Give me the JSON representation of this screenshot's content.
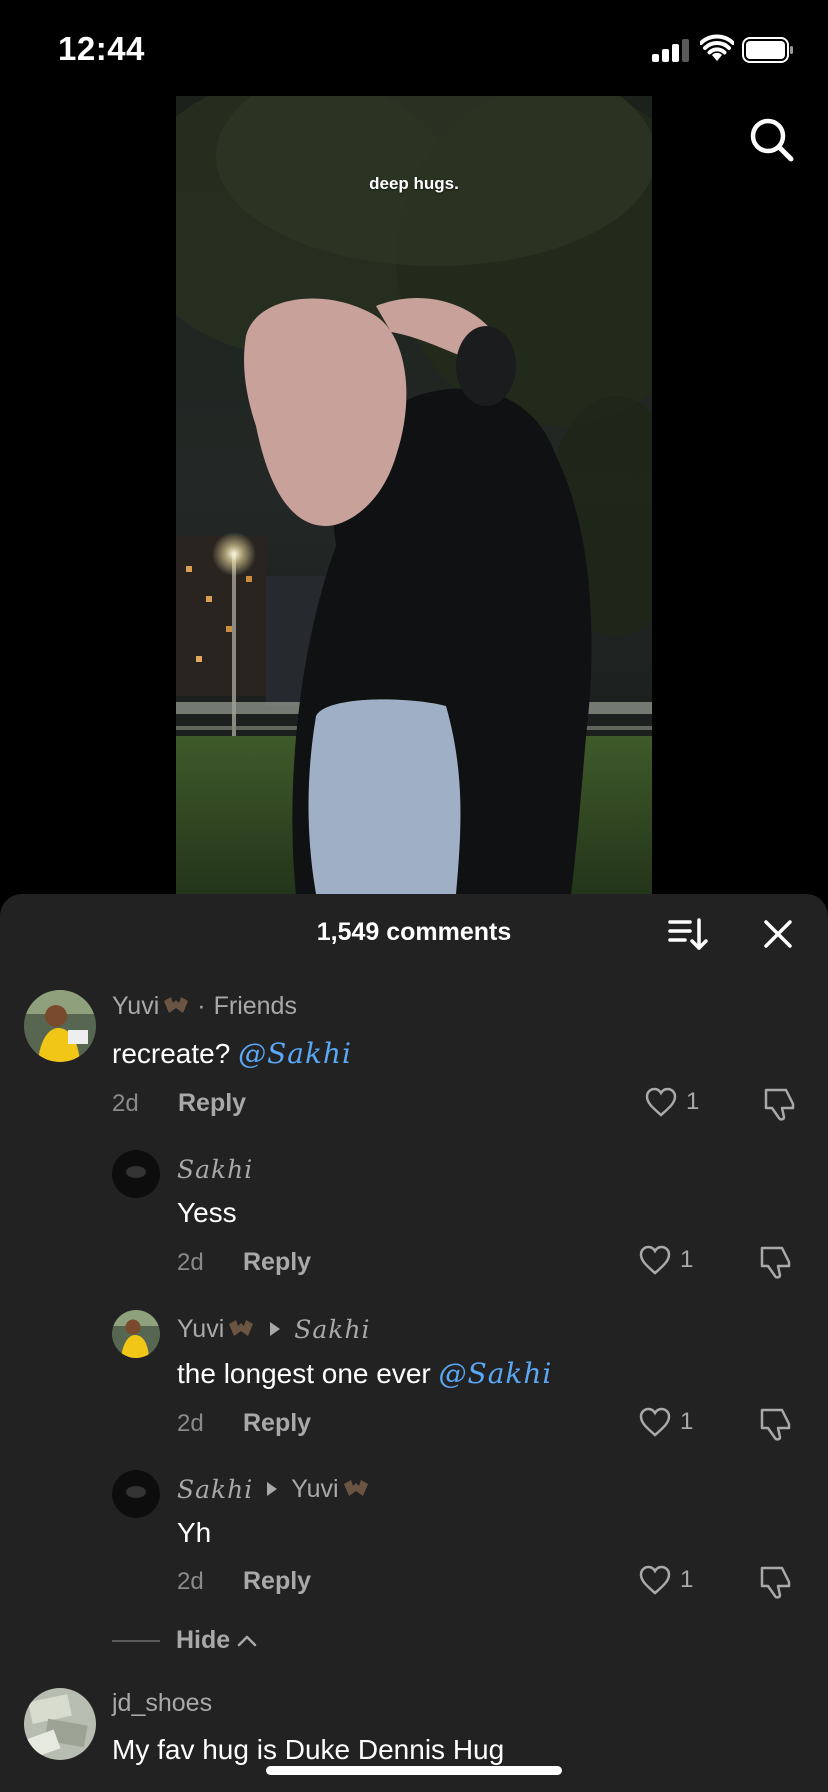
{
  "status_bar": {
    "time": "12:44"
  },
  "video": {
    "caption": "deep hugs."
  },
  "comments_panel": {
    "count_label": "1,549 comments",
    "comments": [
      {
        "username": "Yuvi",
        "tag": "Friends",
        "text": "recreate?",
        "mention": "@Sakhi",
        "time": "2d",
        "reply_label": "Reply",
        "likes": "1"
      },
      {
        "username": "Sakhi",
        "text": "Yess",
        "time": "2d",
        "reply_label": "Reply",
        "likes": "1"
      },
      {
        "username": "Yuvi",
        "reply_to": "Sakhi",
        "text": "the longest one ever",
        "mention": "@Sakhi",
        "time": "2d",
        "reply_label": "Reply",
        "likes": "1"
      },
      {
        "username": "Sakhi",
        "reply_to": "Yuvi",
        "text": "Yh",
        "time": "2d",
        "reply_label": "Reply",
        "likes": "1"
      },
      {
        "username": "jd_shoes",
        "text": "My fav hug is Duke Dennis Hug"
      }
    ],
    "hide_label": "Hide"
  },
  "colors": {
    "sheet_background": "#222222",
    "mention": "#5aa7f5",
    "secondary_text": "#a9a9a9"
  }
}
